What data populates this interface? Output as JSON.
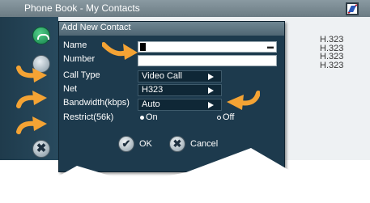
{
  "window": {
    "title": "Phone Book - My Contacts"
  },
  "protocols": [
    "H.323",
    "H.323",
    "H.323",
    "H.323"
  ],
  "rail": {
    "cancel_icon_glyph": "✖"
  },
  "dialog": {
    "title": "Add New Contact",
    "fields": {
      "name_label": "Name",
      "number_label": "Number",
      "calltype_label": "Call Type",
      "net_label": "Net",
      "bandwidth_label": "Bandwidth(kbps)",
      "restrict_label": "Restrict(56k)"
    },
    "values": {
      "name": "",
      "number": "",
      "calltype": "Video Call",
      "net": "H323",
      "bandwidth": "Auto",
      "restrict_on": "On",
      "restrict_off": "Off",
      "restrict_selected": "On"
    },
    "buttons": {
      "ok_label": "OK",
      "ok_icon_glyph": "✔",
      "cancel_label": "Cancel",
      "cancel_icon_glyph": "✖"
    }
  },
  "icons": [
    "phone-icon",
    "video-icon",
    "check-icon",
    "cancel-icon",
    "close-icon"
  ],
  "colors": {
    "dialog_bg": "#1d3a4d",
    "header_bg": "#5f7784",
    "hint_arrow": "#f4a334",
    "rail_bg": "#1f3b4c"
  }
}
